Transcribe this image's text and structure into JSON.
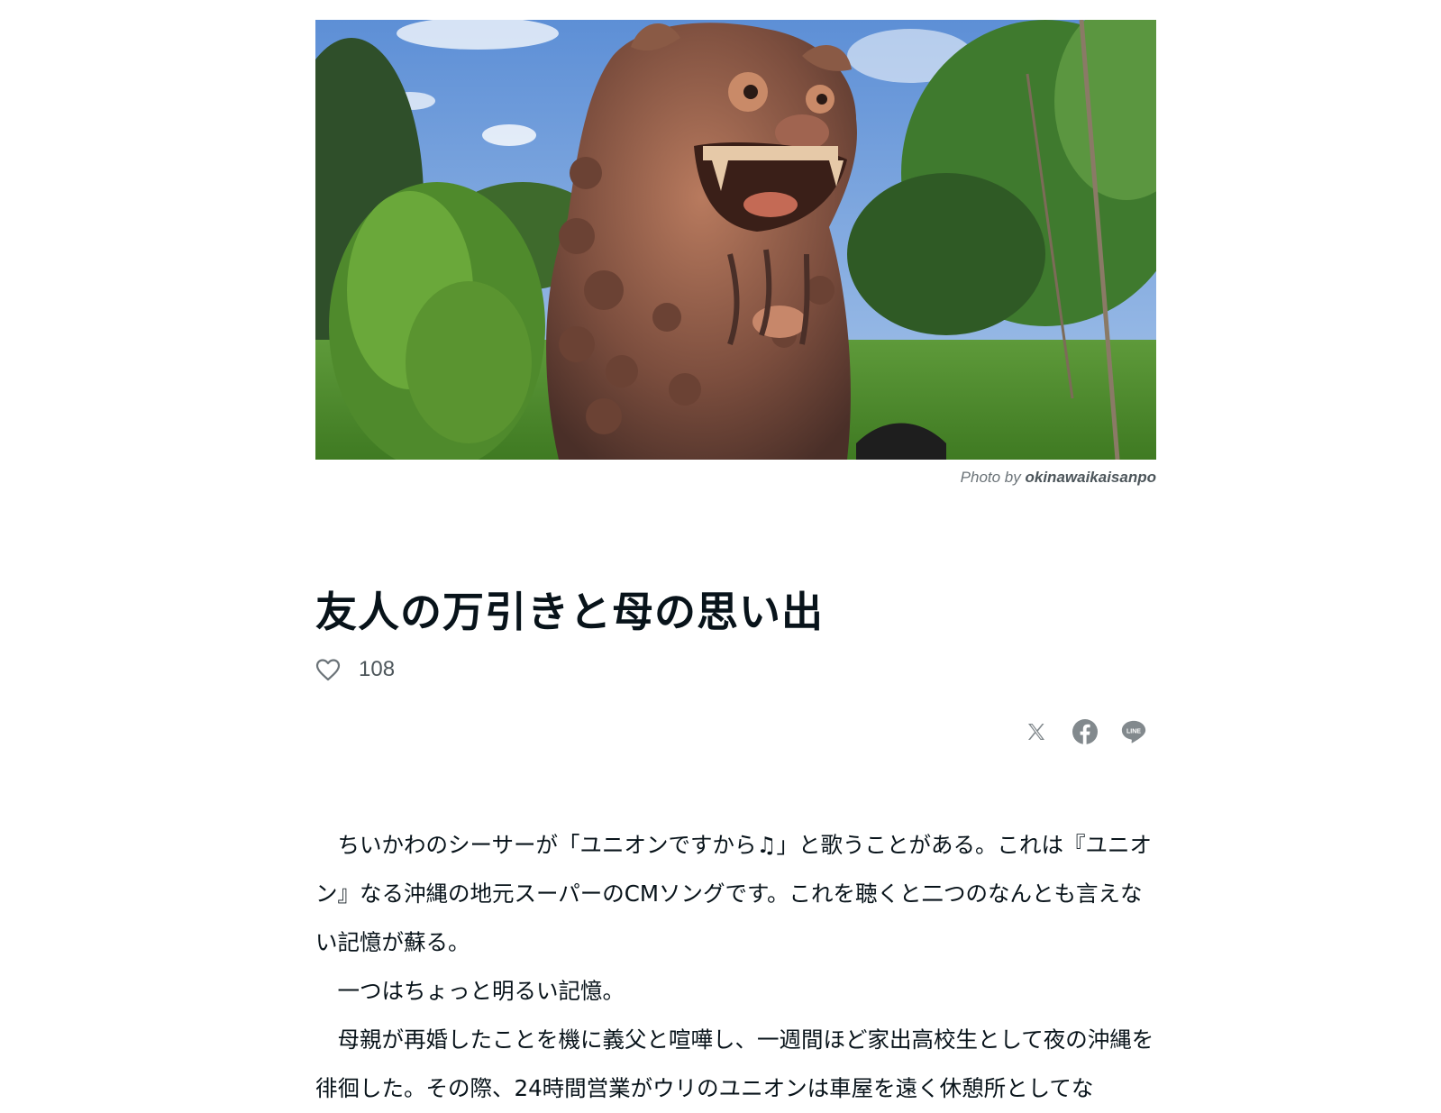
{
  "hero": {
    "credit_prefix": "Photo by",
    "photographer": "okinawaikaisanpo"
  },
  "article": {
    "title": "友人の万引きと母の思い出",
    "like_count": "108"
  },
  "share": {
    "icons": [
      "x-icon",
      "facebook-icon",
      "line-icon"
    ],
    "line_label": "LINE"
  },
  "body": {
    "paragraphs": [
      "ちいかわのシーサーが「ユニオンですから♫」と歌うことがある。これは『ユニオン』なる沖縄の地元スーパーのCMソングです。これを聴くと二つのなんとも言えない記憶が蘇る。",
      "一つはちょっと明るい記憶。",
      "母親が再婚したことを機に義父と喧嘩し、一週間ほど家出高校生として夜の沖縄を徘徊した。その際、24時間営業がウリのユニオンは車屋を遠く休憩所としてな"
    ]
  },
  "colors": {
    "text": "#08131a",
    "muted": "#6b7378",
    "icon": "#82898d"
  }
}
